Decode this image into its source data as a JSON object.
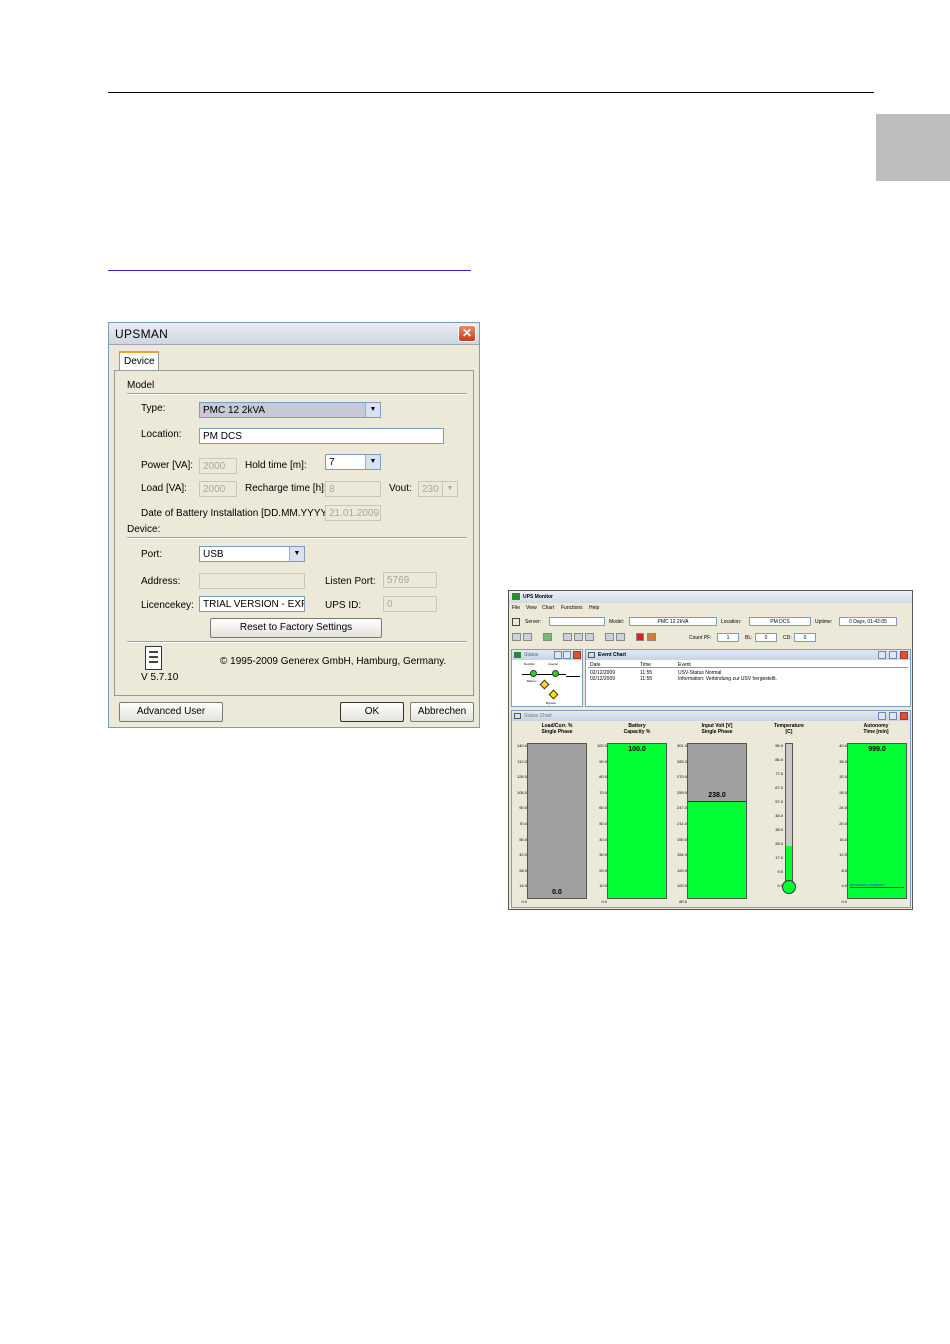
{
  "dialog": {
    "title": "UPSMAN",
    "close_icon": "✕",
    "tab": "Device",
    "model_section": "Model",
    "type_label": "Type:",
    "type_value": "PMC 12 2kVA",
    "location_label": "Location:",
    "location_value": "PM DCS",
    "power_label": "Power [VA]:",
    "power_value": "2000",
    "hold_label": "Hold time [m]:",
    "hold_value": "7",
    "load_label": "Load [VA]:",
    "load_value": "2000",
    "recharge_label": "Recharge time [h]:",
    "recharge_value": "8",
    "vout_label": "Vout:",
    "vout_value": "230",
    "battery_label": "Date of Battery Installation [DD.MM.YYYY]:",
    "battery_value": "21.01.2009",
    "device_section": "Device:",
    "port_label": "Port:",
    "port_value": "USB",
    "address_label": "Address:",
    "address_value": "",
    "listen_label": "Listen Port:",
    "listen_value": "5769",
    "licence_label": "Licencekey:",
    "licence_value": "TRIAL VERSION - EXPI",
    "upsid_label": "UPS ID:",
    "upsid_value": "0",
    "reset_button": "Reset to Factory Settings",
    "copyright": "© 1995-2009 Generex GmbH, Hamburg, Germany.",
    "version": "V  5.7.10",
    "advanced_button": "Advanced User",
    "ok_button": "OK",
    "cancel_button": "Abbrechen"
  },
  "monitor": {
    "title": "UPS Monitor",
    "menu": [
      "File",
      "View",
      "Chart",
      "Functions",
      "Help"
    ],
    "server_label": "Server:",
    "server_value": "",
    "model_label": "Model:",
    "model_value": "PMC 12 2kVA",
    "location_label": "Location:",
    "location_value": "PM DCS",
    "uptime_label": "Uptime:",
    "uptime_value": "0 Days, 01:42:05",
    "countpf_label": "Count PF:",
    "countpf_value": "1",
    "bl_label": "BL:",
    "bl_value": "0",
    "cd_label": "CD:",
    "cd_value": "0",
    "status_title": "Status",
    "status_nodes": [
      "Rectifier",
      "Inverter",
      "Battery",
      "Bypass"
    ],
    "event_title": "Event Chart",
    "event_columns": [
      "Date",
      "Time",
      "Event"
    ],
    "events": [
      {
        "date": "02/12/2009",
        "time": "11:55",
        "event": "USV-Status Normal"
      },
      {
        "date": "02/12/2009",
        "time": "11:55",
        "event": "Information: Verbindung zur USV hergestellt."
      }
    ],
    "statuschart_title": "Status Chart",
    "gauges": [
      {
        "header": "Load/Curr. %\nSingle Phase",
        "value": "0.0",
        "fill": 0.0,
        "ticks": [
          "140.0",
          "112.0",
          "126.0",
          "105.0",
          "90.0",
          "70.0",
          "56.0",
          "42.0",
          "28.0",
          "14.0",
          "0.0"
        ]
      },
      {
        "header": "Battery\nCapacity %",
        "value": "100.0",
        "fill": 1.0,
        "ticks": [
          "100.0",
          "90.0",
          "80.0",
          "70.0",
          "60.0",
          "50.0",
          "40.0",
          "30.0",
          "20.0",
          "10.0",
          "0.0"
        ]
      },
      {
        "header": "Input Volt [V]\nSingle Phase",
        "value": "238.0",
        "fill": 0.63,
        "ticks": [
          "301.0",
          "283.0",
          "270.0",
          "259.0",
          "247.0",
          "211.0",
          "190.0",
          "154.0",
          "120.0",
          "100.0",
          "80.0"
        ]
      },
      {
        "header": "Temperature\n[C]",
        "value": "",
        "fill": 0.26,
        "ticks": [
          "96.0",
          "86.0",
          "77.0",
          "67.0",
          "57.0",
          "48.0",
          "38.0",
          "28.0",
          "17.0",
          "9.0",
          "0.0"
        ]
      },
      {
        "header": "Autonomy\nTime [min]",
        "value": "999.0",
        "fill": 1.0,
        "ticks": [
          "40.0",
          "36.0",
          "32.0",
          "28.0",
          "24.0",
          "20.0",
          "16.0",
          "12.0",
          "8.0",
          "4.0",
          "0.0"
        ],
        "note": "shutdown computer"
      }
    ]
  }
}
